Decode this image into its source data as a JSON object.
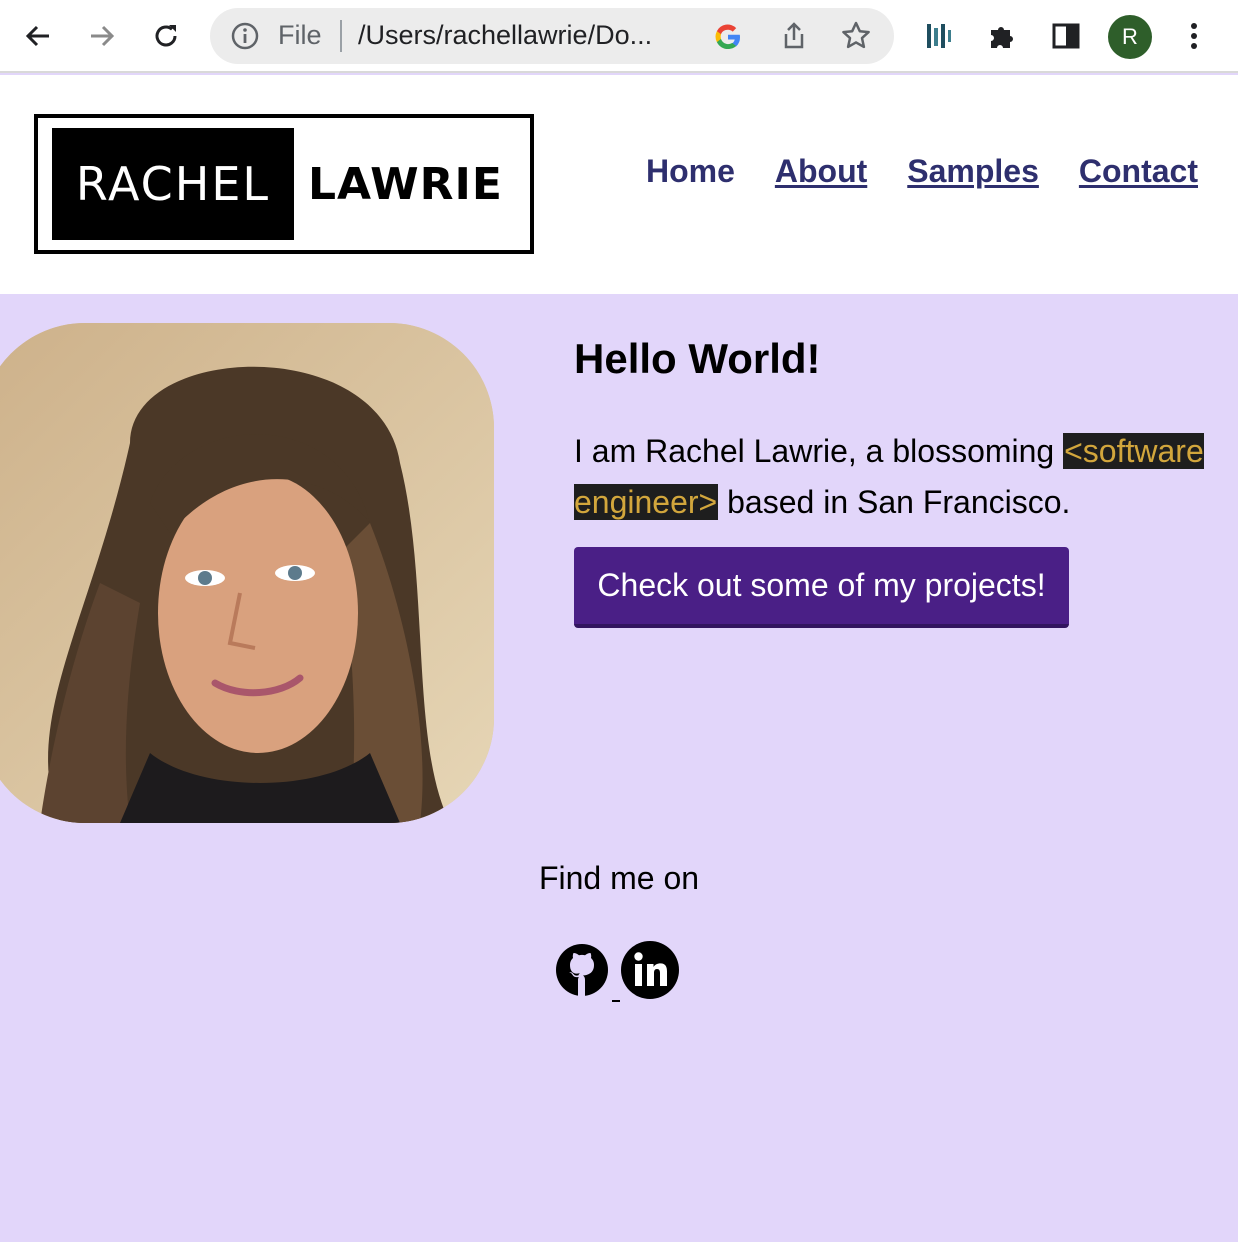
{
  "browser": {
    "scheme_label": "File",
    "url": "/Users/rachellawrie/Do...",
    "profile_initial": "R",
    "icons": [
      "back-arrow-icon",
      "forward-arrow-icon",
      "reload-icon",
      "info-icon",
      "google-icon",
      "share-icon",
      "star-icon",
      "dashlane-icon",
      "extensions-puzzle-icon",
      "side-panel-icon",
      "kebab-menu-icon"
    ]
  },
  "logo": {
    "first": "RACHEL",
    "last": "LAWRIE"
  },
  "nav": {
    "home": "Home",
    "about": "About",
    "samples": "Samples",
    "contact": "Contact"
  },
  "hero": {
    "title": "Hello World!",
    "intro_before": "I am Rachel Lawrie, a blossoming ",
    "intro_code": "<software engineer>",
    "intro_after": " based in San Francisco.",
    "cta": "Check out some of my projects!"
  },
  "social": {
    "heading": "Find me on",
    "icons": [
      "github-icon",
      "linkedin-icon"
    ]
  },
  "colors": {
    "page_bg": "#e2d6fa",
    "nav_link": "#2e2f6e",
    "cta_bg": "#4a1f86",
    "code_bg": "#1e1e1e",
    "code_text": "#d2a63c",
    "avatar_bg": "#2e5e2a"
  }
}
